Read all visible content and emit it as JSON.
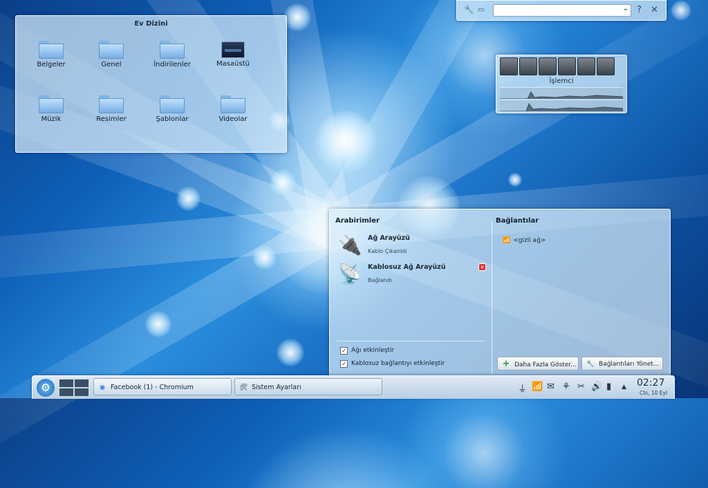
{
  "folder_view": {
    "title": "Ev Dizini",
    "items": [
      {
        "label": "Belgeler",
        "icon": "folder-icon"
      },
      {
        "label": "Genel",
        "icon": "folder-icon"
      },
      {
        "label": "İndirilenler",
        "icon": "folder-icon"
      },
      {
        "label": "Masaüstü",
        "icon": "desktop-icon"
      },
      {
        "label": "Müzik",
        "icon": "folder-icon"
      },
      {
        "label": "Resimler",
        "icon": "folder-icon"
      },
      {
        "label": "Şablonlar",
        "icon": "folder-icon"
      },
      {
        "label": "Videolar",
        "icon": "folder-icon"
      }
    ]
  },
  "top_widget": {
    "search_value": "",
    "help_label": "?",
    "close_label": "✕"
  },
  "cpu_widget": {
    "label": "İşlemci"
  },
  "network": {
    "interfaces_title": "Arabirimler",
    "connections_title": "Bağlantılar",
    "interfaces": [
      {
        "name": "Ağ Arayüzü",
        "status": "Kablo Çıkanldı",
        "icon": "wired-network-icon"
      },
      {
        "name": "Kablosuz Ağ Arayüzü",
        "status": "Bağlandı",
        "icon": "wireless-network-icon"
      }
    ],
    "checkbox_network": "Ağı etkinleştir",
    "checkbox_wireless": "Kablosuz bağlantıyı etkinleştir",
    "hidden_network": "<gizli ağ>",
    "show_more_button": "Daha Fazla Göster...",
    "manage_button": "Bağlantıları Yönet..."
  },
  "taskbar": {
    "tasks": [
      {
        "label": "Facebook (1) - Chromium",
        "icon": "chromium-icon"
      },
      {
        "label": "Sistem Ayarları",
        "icon": "settings-tools-icon"
      }
    ],
    "clock_time": "02:27",
    "clock_date": "Cts, 10 Eyl"
  }
}
